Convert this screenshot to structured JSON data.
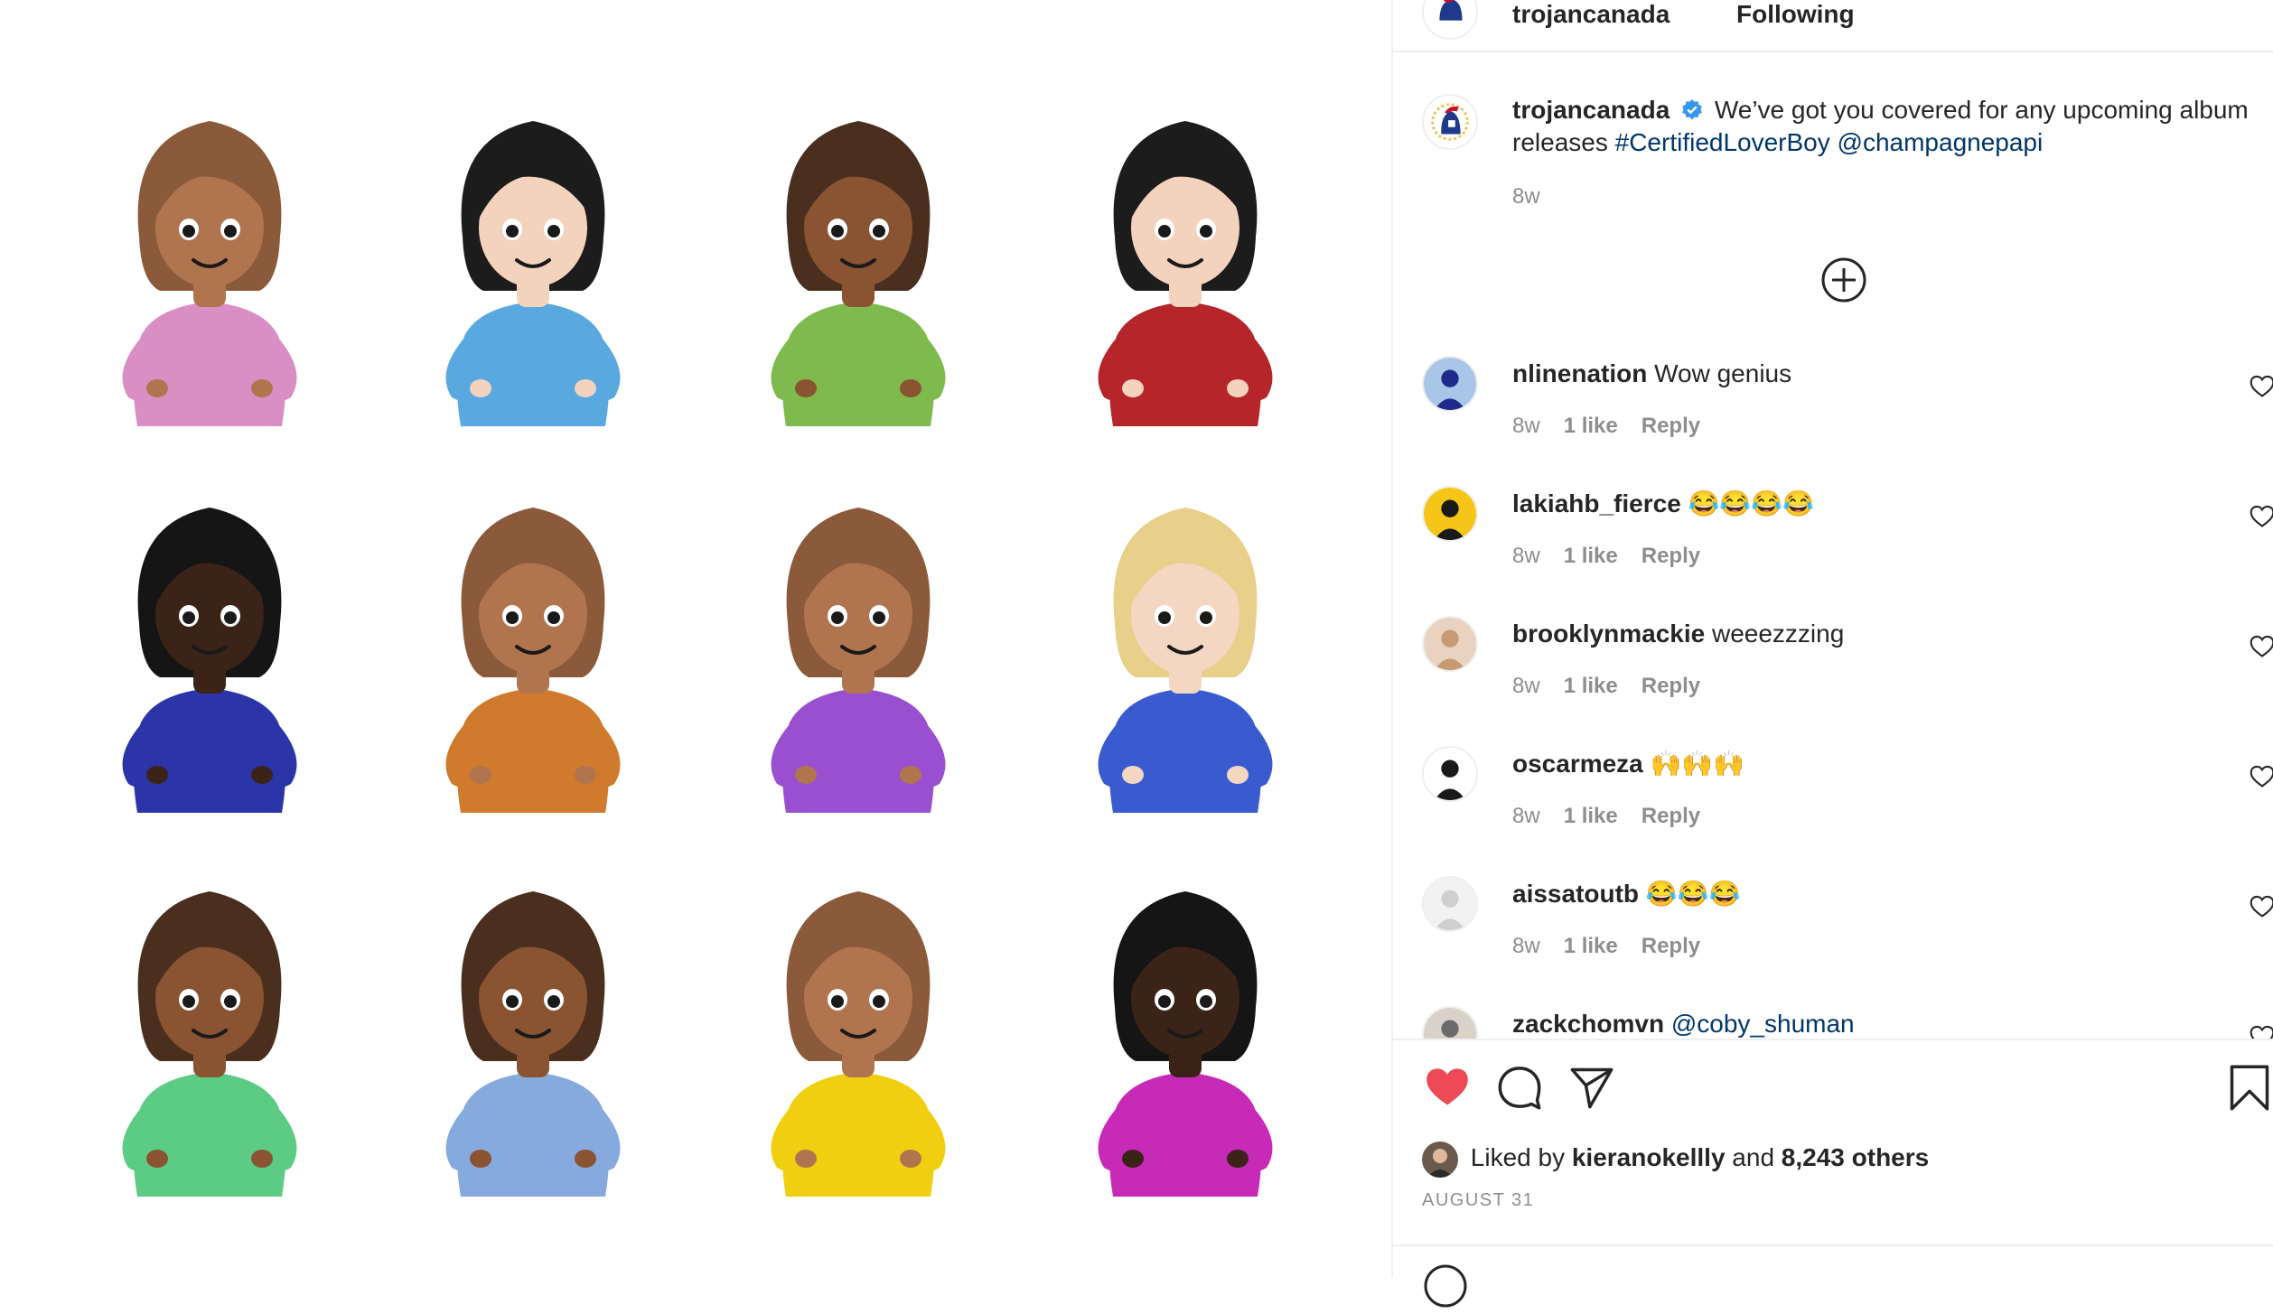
{
  "post": {
    "author": "trojancanada",
    "header_status": "Following",
    "caption_text": "We’ve got you covered for any upcoming album releases",
    "caption_hashtag": "#CertifiedLoverBoy",
    "caption_mention": "@champagnepapi",
    "caption_time": "8w"
  },
  "image": {
    "emoji_grid": [
      {
        "skin": "#b0754e",
        "hair": "#8b5a3a",
        "shirt": "#d98ec4"
      },
      {
        "skin": "#f3d3bd",
        "hair": "#1c1c1c",
        "shirt": "#5aa8e0"
      },
      {
        "skin": "#8a5331",
        "hair": "#4a2e1e",
        "shirt": "#7fba4e"
      },
      {
        "skin": "#f3d3bd",
        "hair": "#1c1c1c",
        "shirt": "#b5252a"
      },
      {
        "skin": "#3b2318",
        "hair": "#151515",
        "shirt": "#2b35a8"
      },
      {
        "skin": "#b0754e",
        "hair": "#8b5a3a",
        "shirt": "#cf7a2c"
      },
      {
        "skin": "#b0754e",
        "hair": "#8b5a3a",
        "shirt": "#9a4fd0"
      },
      {
        "skin": "#f4d7c2",
        "hair": "#e8cf8a",
        "shirt": "#3a5bd0"
      },
      {
        "skin": "#8a5331",
        "hair": "#4a2e1e",
        "shirt": "#5ccb84"
      },
      {
        "skin": "#8a5331",
        "hair": "#4a2e1e",
        "shirt": "#86aadd"
      },
      {
        "skin": "#b0754e",
        "hair": "#8b5a3a",
        "shirt": "#f0cf10"
      },
      {
        "skin": "#3b2318",
        "hair": "#151515",
        "shirt": "#c82ab8"
      }
    ]
  },
  "comments": [
    {
      "username": "nlinenation",
      "text": "Wow genius",
      "time": "8w",
      "likes": "1 like",
      "reply": "Reply"
    },
    {
      "username": "lakiahb_fierce",
      "text": "😂😂😂😂",
      "time": "8w",
      "likes": "1 like",
      "reply": "Reply"
    },
    {
      "username": "brooklynmackie",
      "text": "weeezzzing",
      "time": "8w",
      "likes": "1 like",
      "reply": "Reply"
    },
    {
      "username": "oscarmeza",
      "text": "🙌🙌🙌",
      "time": "8w",
      "likes": "1 like",
      "reply": "Reply"
    },
    {
      "username": "aissatoutb",
      "text": "😂😂😂",
      "time": "8w",
      "likes": "1 like",
      "reply": "Reply"
    },
    {
      "username": "zackchomvn",
      "text": "@coby_shuman",
      "time": "",
      "likes": "",
      "reply": ""
    }
  ],
  "likes": {
    "prefix": "Liked by",
    "user": "kieranokellly",
    "joiner": "and",
    "others": "8,243 others"
  },
  "date": "AUGUST 31",
  "colors": {
    "heart_liked": "#ed4956",
    "link": "#00376b",
    "verified": "#3897f0",
    "muted": "#8e8e8e"
  }
}
